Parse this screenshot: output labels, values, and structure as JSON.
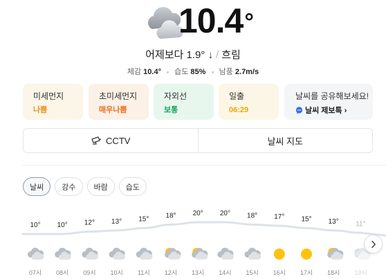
{
  "current": {
    "temperature": "10.4",
    "degree_symbol": "°",
    "condition_icon": "cloud-icon",
    "comparison": "어제보다 1.9° ↓",
    "condition": "흐림"
  },
  "details": [
    {
      "label": "체감",
      "value": "10.4°"
    },
    {
      "label": "습도",
      "value": "85%"
    },
    {
      "label": "남풍",
      "value": "2.7m/s"
    }
  ],
  "cards": [
    {
      "label": "미세먼지",
      "value": "나쁨",
      "value_color": "#f08c1b"
    },
    {
      "label": "초미세먼지",
      "value": "매우나쁨",
      "value_color": "#f06a1b"
    },
    {
      "label": "자외선",
      "value": "보통",
      "value_color": "#17a35b"
    },
    {
      "label": "일출",
      "value": "06:29",
      "value_color": "#f2a400"
    }
  ],
  "share": {
    "title": "날씨를 공유해보세요!",
    "link": "날씨 제보톡 ›",
    "icon": "chat-bubble-icon",
    "icon_color": "#2d6df6"
  },
  "toolbar": {
    "cctv_label": "CCTV",
    "cctv_icon": "cctv-camera-icon",
    "map_label": "날씨 지도"
  },
  "tabs": [
    "날씨",
    "강수",
    "바람",
    "습도"
  ],
  "active_tab": "날씨",
  "chart_data": {
    "type": "line",
    "x": [
      "07시",
      "08시",
      "09시",
      "10시",
      "11시",
      "12시",
      "13시",
      "14시",
      "15시",
      "16시",
      "17시",
      "18시",
      "19시"
    ],
    "series": [
      {
        "values": [
          10,
          10,
          12,
          13,
          15,
          18,
          20,
          20,
          18,
          17,
          15,
          13,
          11
        ]
      }
    ],
    "value_labels": [
      "10°",
      "10°",
      "12°",
      "13°",
      "15°",
      "18°",
      "20°",
      "20°",
      "18°",
      "17°",
      "15°",
      "13°",
      "11°"
    ],
    "icons": [
      "cloud-icon",
      "cloud-icon",
      "cloud-icon",
      "cloud-icon",
      "cloud-icon",
      "partly-sunny-icon",
      "partly-sunny-icon",
      "cloud-icon",
      "cloud-icon",
      "sun-icon",
      "sun-icon",
      "partly-sunny-icon",
      "partly-cloudy-night-icon"
    ],
    "line_color": "#dde2ea",
    "grid": false
  }
}
